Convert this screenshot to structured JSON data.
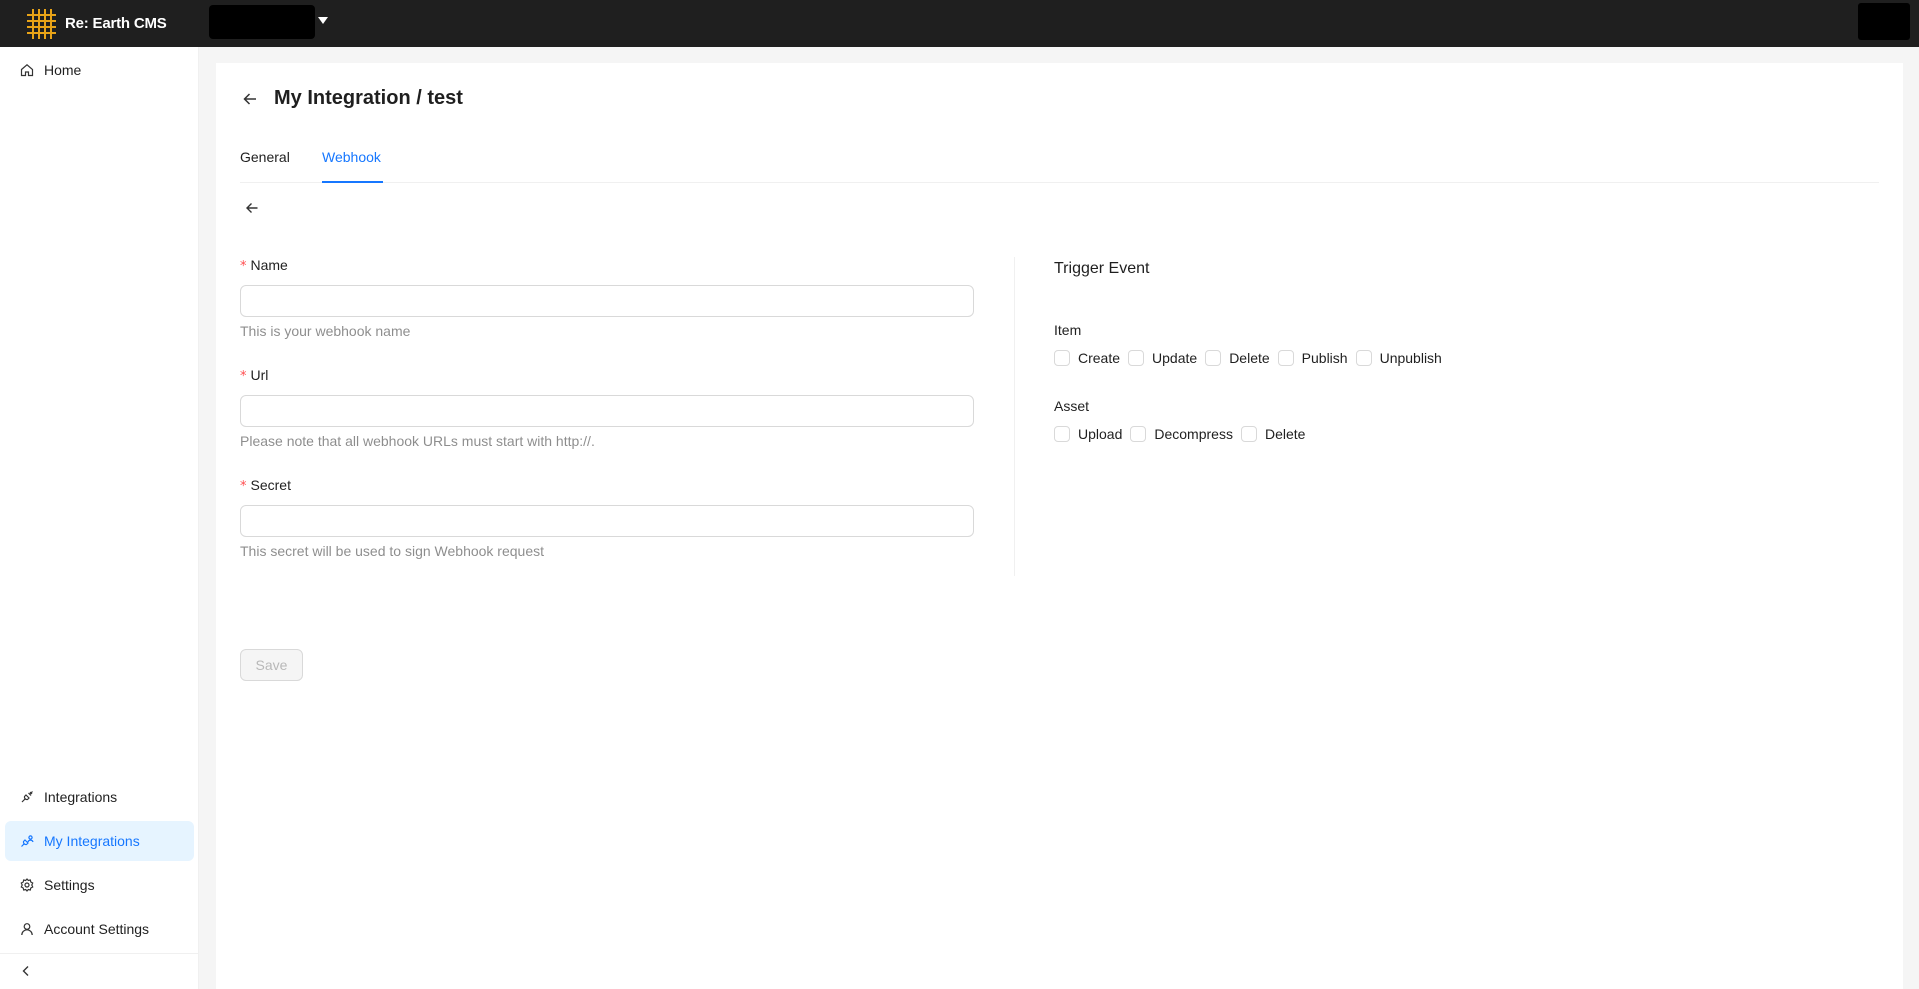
{
  "app": {
    "name": "Re: Earth CMS",
    "logo_icon": "grid-logo-icon",
    "accent_color": "#1677ff",
    "brand_color": "#e8a317"
  },
  "header": {
    "workspace_icon": "caret-down-icon"
  },
  "sidebar": {
    "top_items": [
      {
        "label": "Home",
        "icon": "home-icon"
      }
    ],
    "bottom_items": [
      {
        "label": "Integrations",
        "icon": "integration-icon"
      },
      {
        "label": "My Integrations",
        "icon": "my-integration-icon",
        "active": true
      },
      {
        "label": "Settings",
        "icon": "gear-icon"
      },
      {
        "label": "Account Settings",
        "icon": "user-icon"
      }
    ],
    "collapse_icon": "chevron-left-icon"
  },
  "page": {
    "title": "My Integration / test",
    "tabs": [
      {
        "label": "General",
        "active": false
      },
      {
        "label": "Webhook",
        "active": true
      }
    ]
  },
  "form": {
    "name": {
      "label": "Name",
      "required_mark": "*",
      "value": "",
      "help": "This is your webhook name"
    },
    "url": {
      "label": "Url",
      "required_mark": "*",
      "value": "",
      "help": "Please note that all webhook URLs must start with http://."
    },
    "secret": {
      "label": "Secret",
      "required_mark": "*",
      "value": "",
      "help": "This secret will be used to sign Webhook request"
    },
    "save_label": "Save"
  },
  "trigger": {
    "title": "Trigger Event",
    "item": {
      "label": "Item",
      "options": [
        "Create",
        "Update",
        "Delete",
        "Publish",
        "Unpublish"
      ]
    },
    "asset": {
      "label": "Asset",
      "options": [
        "Upload",
        "Decompress",
        "Delete"
      ]
    }
  }
}
